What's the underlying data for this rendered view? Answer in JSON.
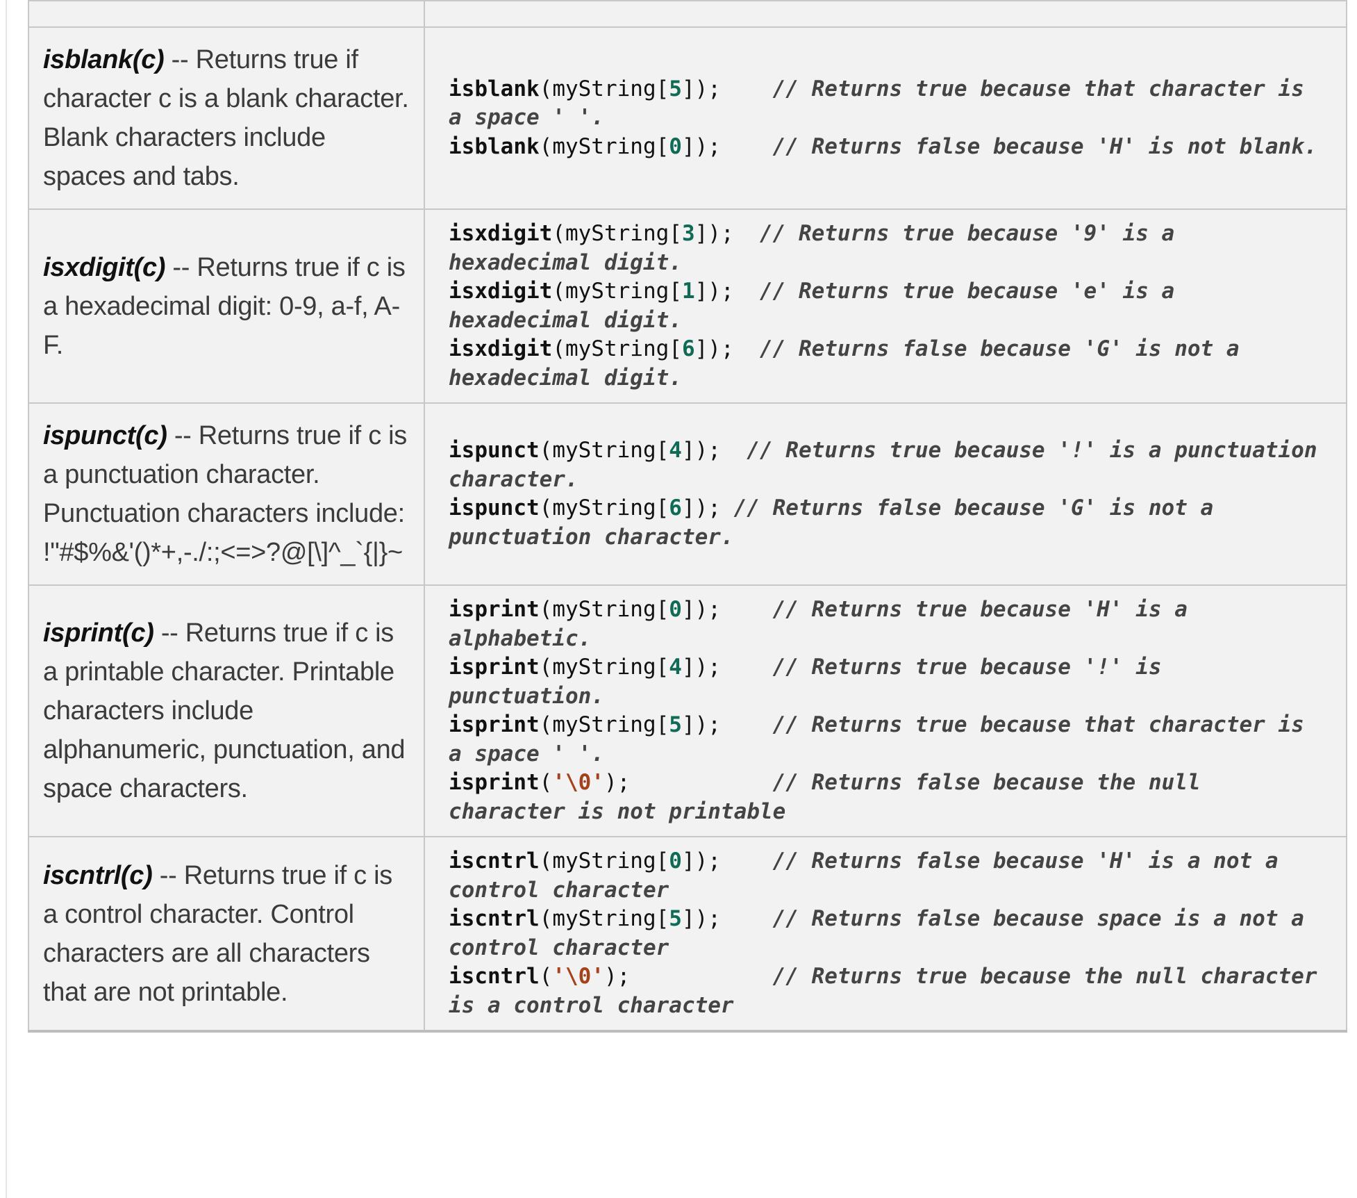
{
  "rows": [
    {
      "func": "isblank(c)",
      "description": " -- Returns true if character c is a blank character. Blank characters include spaces and tabs.",
      "code": [
        {
          "call": "isblank",
          "arg_type": "index",
          "arg": "5",
          "pad": "    ",
          "comment": "// Returns true because that character is a space ' '."
        },
        {
          "call": "isblank",
          "arg_type": "index",
          "arg": "0",
          "pad": "    ",
          "comment": "// Returns false because 'H' is not blank."
        }
      ]
    },
    {
      "func": "isxdigit(c)",
      "description": " -- Returns true if c is a hexadecimal digit: 0-9, a-f, A-F.",
      "code": [
        {
          "call": "isxdigit",
          "arg_type": "index",
          "arg": "3",
          "pad": "  ",
          "comment": "// Returns true because '9' is a hexadecimal digit."
        },
        {
          "call": "isxdigit",
          "arg_type": "index",
          "arg": "1",
          "pad": "  ",
          "comment": "// Returns true because 'e' is a hexadecimal digit."
        },
        {
          "call": "isxdigit",
          "arg_type": "index",
          "arg": "6",
          "pad": "  ",
          "comment": "// Returns false because 'G' is not a hexadecimal digit."
        }
      ]
    },
    {
      "func": "ispunct(c)",
      "description": " -- Returns true if c is a punctuation character. Punctuation characters include: !\"#$%&'()*+,-./:;<=>?@[\\]^_`{|}~",
      "code": [
        {
          "call": "ispunct",
          "arg_type": "index",
          "arg": "4",
          "pad": "  ",
          "comment": "// Returns true because '!' is a punctuation character."
        },
        {
          "call": "ispunct",
          "arg_type": "index",
          "arg": "6",
          "pad": " ",
          "comment": "// Returns false because 'G' is not a punctuation character."
        }
      ]
    },
    {
      "func": "isprint(c)",
      "description": " -- Returns true if c is a printable character. Printable characters include alphanumeric, punctuation, and space characters.",
      "code": [
        {
          "call": "isprint",
          "arg_type": "index",
          "arg": "0",
          "pad": "    ",
          "comment": "// Returns true because 'H' is a alphabetic."
        },
        {
          "call": "isprint",
          "arg_type": "index",
          "arg": "4",
          "pad": "    ",
          "comment": "// Returns true because '!' is punctuation."
        },
        {
          "call": "isprint",
          "arg_type": "index",
          "arg": "5",
          "pad": "    ",
          "comment": "// Returns true because that character is a space ' '."
        },
        {
          "call": "isprint",
          "arg_type": "char",
          "arg": "'\\0'",
          "pad": "           ",
          "comment": "// Returns false because the null character is not printable"
        }
      ]
    },
    {
      "func": "iscntrl(c)",
      "description": " -- Returns true if c is a control character. Control characters are all characters that are not printable.",
      "code": [
        {
          "call": "iscntrl",
          "arg_type": "index",
          "arg": "0",
          "pad": "    ",
          "comment": "// Returns false because 'H' is a not a control character"
        },
        {
          "call": "iscntrl",
          "arg_type": "index",
          "arg": "5",
          "pad": "    ",
          "comment": "// Returns false because space is a not a control character"
        },
        {
          "call": "iscntrl",
          "arg_type": "char",
          "arg": "'\\0'",
          "pad": "           ",
          "comment": "// Returns true because the null character is a control character"
        }
      ]
    }
  ]
}
